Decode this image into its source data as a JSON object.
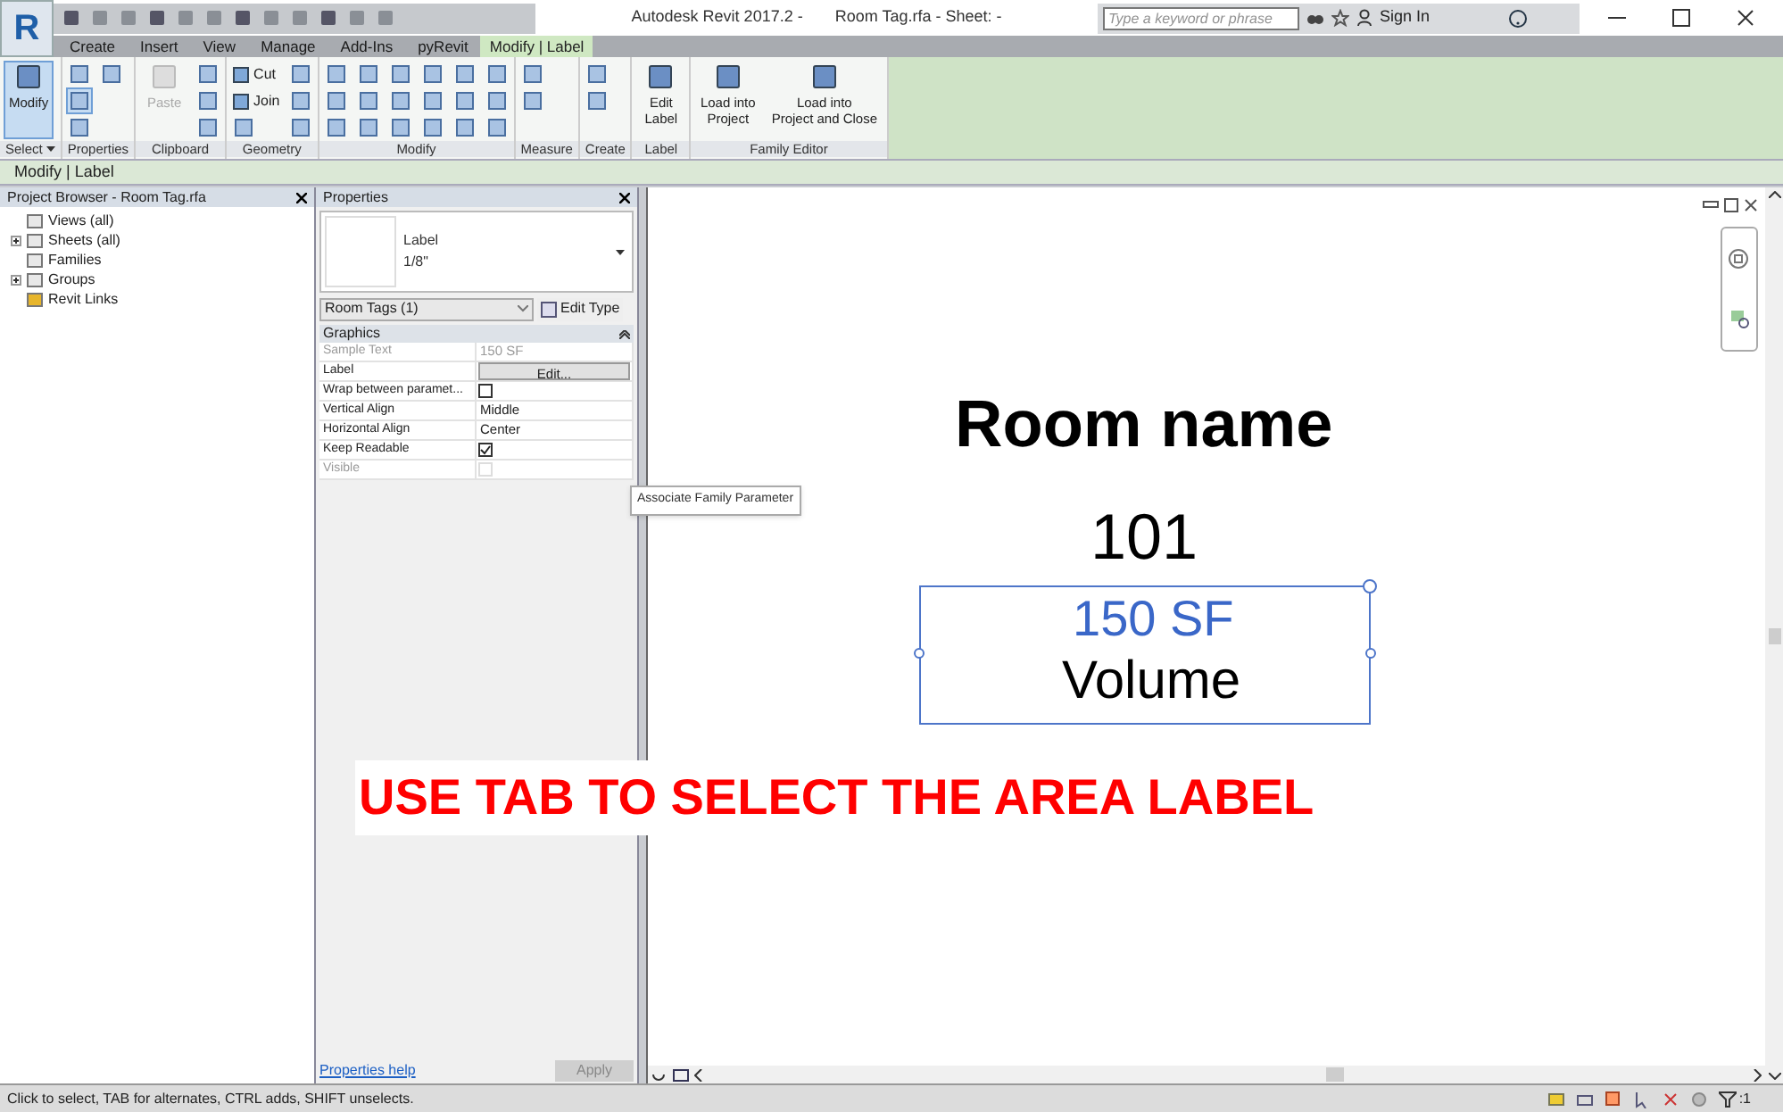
{
  "app_button": {
    "letter": "R"
  },
  "window": {
    "title": "Autodesk Revit 2017.2 -",
    "document": "Room Tag.rfa - Sheet: -"
  },
  "infocenter": {
    "placeholder": "Type a keyword or phrase",
    "sign_in": "Sign In"
  },
  "ribbon_tabs": [
    {
      "label": "Create",
      "selected": false
    },
    {
      "label": "Insert",
      "selected": false
    },
    {
      "label": "View",
      "selected": false
    },
    {
      "label": "Manage",
      "selected": false
    },
    {
      "label": "Add-Ins",
      "selected": false
    },
    {
      "label": "pyRevit",
      "selected": false
    },
    {
      "label": "Modify | Label",
      "selected": true
    }
  ],
  "ribbon_panels": [
    {
      "title": "Select",
      "tools": [
        {
          "kind": "large",
          "label": "Modify",
          "selected": true
        }
      ]
    },
    {
      "title": "Properties",
      "tools": [
        {
          "kind": "icon",
          "selected": false
        },
        {
          "kind": "icon",
          "selected": true
        },
        {
          "kind": "icon",
          "selected": false
        },
        {
          "kind": "icon",
          "selected": false
        }
      ]
    },
    {
      "title": "Clipboard",
      "tools": [
        {
          "kind": "large",
          "label": "Paste",
          "selected": false,
          "disabled": true
        },
        {
          "kind": "icon",
          "selected": false
        },
        {
          "kind": "icon",
          "selected": false
        },
        {
          "kind": "icon",
          "selected": false
        }
      ]
    },
    {
      "title": "Geometry",
      "tools": [
        {
          "kind": "small",
          "label": "Cut",
          "selected": false
        },
        {
          "kind": "small",
          "label": "Join",
          "selected": false
        },
        {
          "kind": "icon",
          "selected": false
        },
        {
          "kind": "icon",
          "selected": false
        },
        {
          "kind": "icon",
          "selected": false
        },
        {
          "kind": "icon",
          "selected": false
        }
      ]
    },
    {
      "title": "Modify",
      "tools": [
        {
          "kind": "icon",
          "selected": false
        },
        {
          "kind": "icon",
          "selected": false
        },
        {
          "kind": "icon",
          "selected": false
        },
        {
          "kind": "icon",
          "selected": false
        },
        {
          "kind": "icon",
          "selected": false
        },
        {
          "kind": "icon",
          "selected": false
        },
        {
          "kind": "icon",
          "selected": false
        },
        {
          "kind": "icon",
          "selected": false
        },
        {
          "kind": "icon",
          "selected": false
        },
        {
          "kind": "icon",
          "selected": false
        },
        {
          "kind": "icon",
          "selected": false
        },
        {
          "kind": "icon",
          "selected": false
        },
        {
          "kind": "icon",
          "selected": false
        },
        {
          "kind": "icon",
          "selected": false
        },
        {
          "kind": "icon",
          "selected": false
        },
        {
          "kind": "icon",
          "selected": false
        },
        {
          "kind": "icon",
          "selected": false
        },
        {
          "kind": "icon",
          "selected": false
        }
      ]
    },
    {
      "title": "Measure",
      "tools": [
        {
          "kind": "icon",
          "selected": false
        },
        {
          "kind": "icon",
          "selected": false
        }
      ]
    },
    {
      "title": "Create",
      "tools": [
        {
          "kind": "icon",
          "selected": false
        },
        {
          "kind": "icon",
          "selected": false
        }
      ]
    },
    {
      "title": "Label",
      "tools": [
        {
          "kind": "large",
          "label": "Edit\nLabel",
          "selected": false
        }
      ]
    },
    {
      "title": "Family Editor",
      "tools": [
        {
          "kind": "large",
          "label": "Load into\nProject",
          "selected": false
        },
        {
          "kind": "large",
          "label": "Load into\nProject and Close",
          "selected": false
        }
      ]
    }
  ],
  "options_bar": {
    "label": "Modify | Label"
  },
  "project_browser": {
    "title": "Project Browser - Room Tag.rfa",
    "items": [
      {
        "label": "Views (all)",
        "collapsed": false
      },
      {
        "label": "Sheets (all)",
        "collapsed": true
      },
      {
        "label": "Families",
        "collapsed": false
      },
      {
        "label": "Groups",
        "collapsed": true
      },
      {
        "label": "Revit Links",
        "collapsed": false
      }
    ]
  },
  "properties": {
    "title": "Properties",
    "type_name": "Label",
    "type_size": "1/8\"",
    "instance_filter": "Room Tags (1)",
    "edit_type": "Edit Type",
    "section": "Graphics",
    "rows": [
      {
        "name": "Sample Text",
        "kind": "text",
        "value": "150 SF",
        "disabled": true
      },
      {
        "name": "Label",
        "kind": "button",
        "value": "Edit...",
        "disabled": false
      },
      {
        "name": "Wrap between paramet...",
        "kind": "checkbox",
        "checked": false,
        "disabled": false
      },
      {
        "name": "Vertical Align",
        "kind": "text",
        "value": "Middle",
        "disabled": false
      },
      {
        "name": "Horizontal Align",
        "kind": "text",
        "value": "Center",
        "disabled": false
      },
      {
        "name": "Keep Readable",
        "kind": "checkbox",
        "checked": true,
        "disabled": false
      },
      {
        "name": "Visible",
        "kind": "checkbox",
        "checked": false,
        "disabled": true
      }
    ],
    "help": "Properties help",
    "apply": "Apply"
  },
  "tooltip": "Associate Family Parameter",
  "canvas": {
    "room_name": "Room name",
    "number": "101",
    "area": "150 SF",
    "volume": "Volume",
    "annotation": "USE TAB TO SELECT THE AREA LABEL"
  },
  "status_bar": {
    "message": "Click to select, TAB for alternates, CTRL adds, SHIFT unselects.",
    "filter_count": ":1"
  }
}
